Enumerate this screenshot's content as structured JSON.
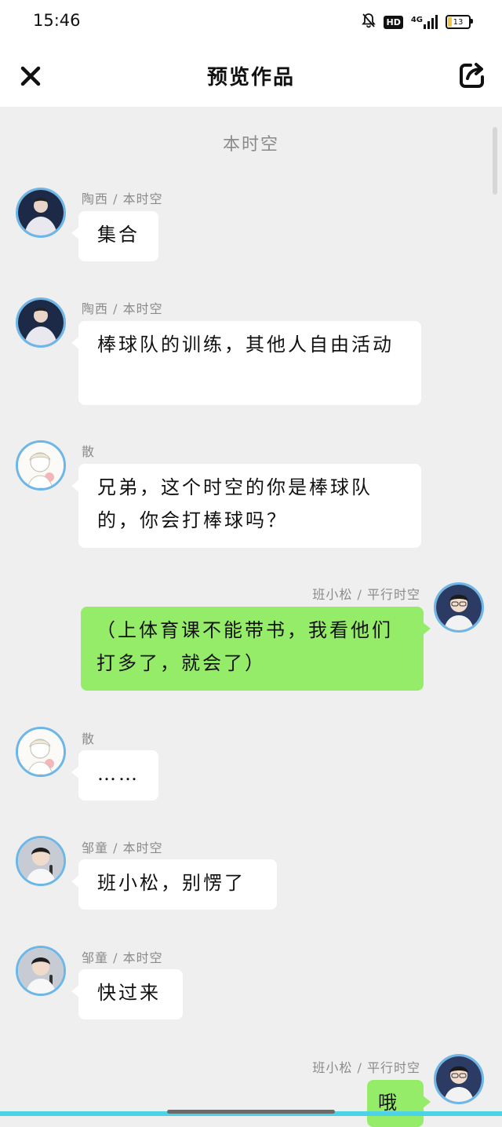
{
  "status_bar": {
    "time": "15:46",
    "hd": "HD",
    "network": "4G",
    "battery": "13"
  },
  "nav": {
    "title": "预览作品"
  },
  "section_label": "本时空",
  "messages": [
    {
      "side": "left",
      "sender": "陶西 / 本时空",
      "text": "集合"
    },
    {
      "side": "left",
      "sender": "陶西 / 本时空",
      "text": "棒球队的训练，其他人自由活动"
    },
    {
      "side": "left",
      "sender": "散",
      "text": "兄弟，这个时空的你是棒球队的，你会打棒球吗？"
    },
    {
      "side": "right",
      "sender": "班小松 / 平行时空",
      "text": "（上体育课不能带书，我看他们打多了，就会了）"
    },
    {
      "side": "left",
      "sender": "散",
      "text": "……"
    },
    {
      "side": "left",
      "sender": "邹童 / 本时空",
      "text": "班小松，别愣了"
    },
    {
      "side": "left",
      "sender": "邹童 / 本时空",
      "text": "快过来"
    },
    {
      "side": "right",
      "sender": "班小松 / 平行时空",
      "text": "哦"
    }
  ]
}
